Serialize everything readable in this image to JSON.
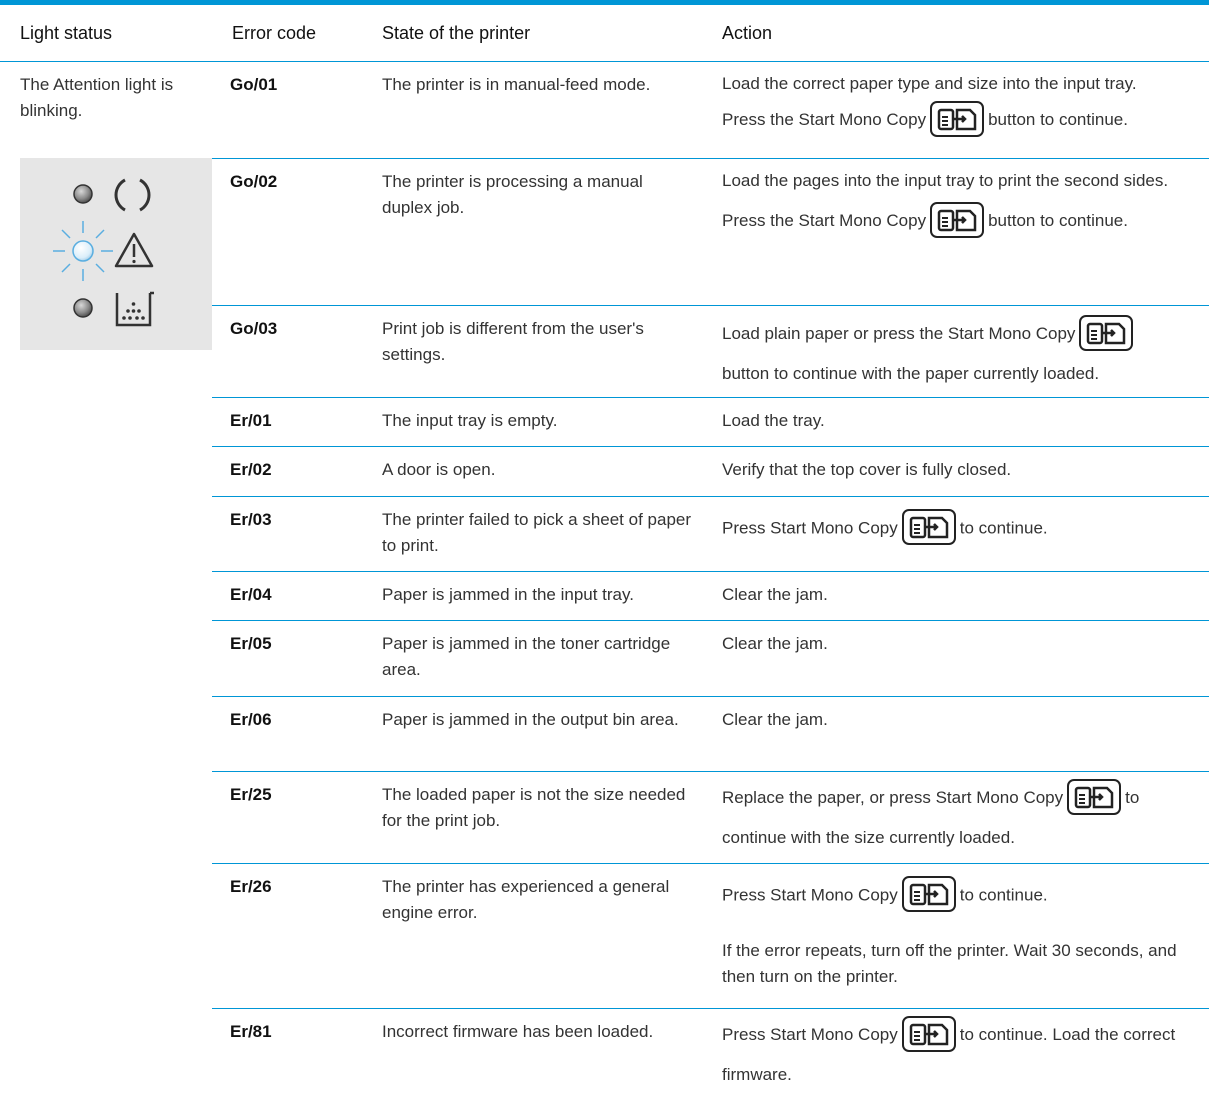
{
  "headers": {
    "light_status": "Light status",
    "error_code": "Error code",
    "state": "State of the printer",
    "action": "Action"
  },
  "light_status_text": "The Attention light is blinking.",
  "icons": {
    "led": "led-off-icon",
    "led_blink": "led-blinking-icon",
    "power": "power-icon",
    "attention": "attention-warning-icon",
    "toner": "toner-cartridge-icon",
    "start_copy": "start-mono-copy-icon"
  },
  "colors": {
    "accent": "#0096d6",
    "panel": "#e6e6e6"
  },
  "rows": [
    {
      "code": "Go/01",
      "state": "The printer is in manual-feed mode.",
      "action_a": "Load the correct paper type and size into the input tray.",
      "action_b": "Press the Start Mono Copy",
      "action_c": "button to continue."
    },
    {
      "code": "Go/02",
      "state": "The printer is processing a manual duplex job.",
      "action_a": "Load the pages into the input tray to print the second sides. Press the Start Mono Copy",
      "action_b": "button to continue."
    },
    {
      "code": "Go/03",
      "state": "Print job is different from the user's settings.",
      "action_a": "Load plain paper or press the Start Mono Copy",
      "action_b": "button to continue with the paper currently loaded."
    },
    {
      "code": "Er/01",
      "state": "The input tray is empty.",
      "action": "Load the tray."
    },
    {
      "code": "Er/02",
      "state": "A door is open.",
      "action": "Verify that the top cover is fully closed."
    },
    {
      "code": "Er/03",
      "state": "The printer failed to pick a sheet of paper to print.",
      "action_a": "Press Start Mono Copy",
      "action_b": "to continue."
    },
    {
      "code": "Er/04",
      "state": "Paper is jammed in the input tray.",
      "action": "Clear the jam."
    },
    {
      "code": "Er/05",
      "state": "Paper is jammed in the toner cartridge area.",
      "action": "Clear the jam."
    },
    {
      "code": "Er/06",
      "state": "Paper is jammed in the output bin area.",
      "action": "Clear the jam."
    },
    {
      "code": "Er/25",
      "state": "The loaded paper is not the size needed for the print job.",
      "action_a": "Replace the paper, or press Start Mono Copy",
      "action_b": "to continue with the size currently loaded."
    },
    {
      "code": "Er/26",
      "state": "The printer has experienced a general engine error.",
      "action_a": "Press Start Mono Copy",
      "action_b": "to continue.",
      "action_c": "If the error repeats, turn off the printer. Wait 30 seconds, and then turn on the printer."
    },
    {
      "code": "Er/81",
      "state": "Incorrect firmware has been loaded.",
      "action_a": "Press Start Mono Copy",
      "action_b": "to continue. Load the correct firmware."
    }
  ]
}
